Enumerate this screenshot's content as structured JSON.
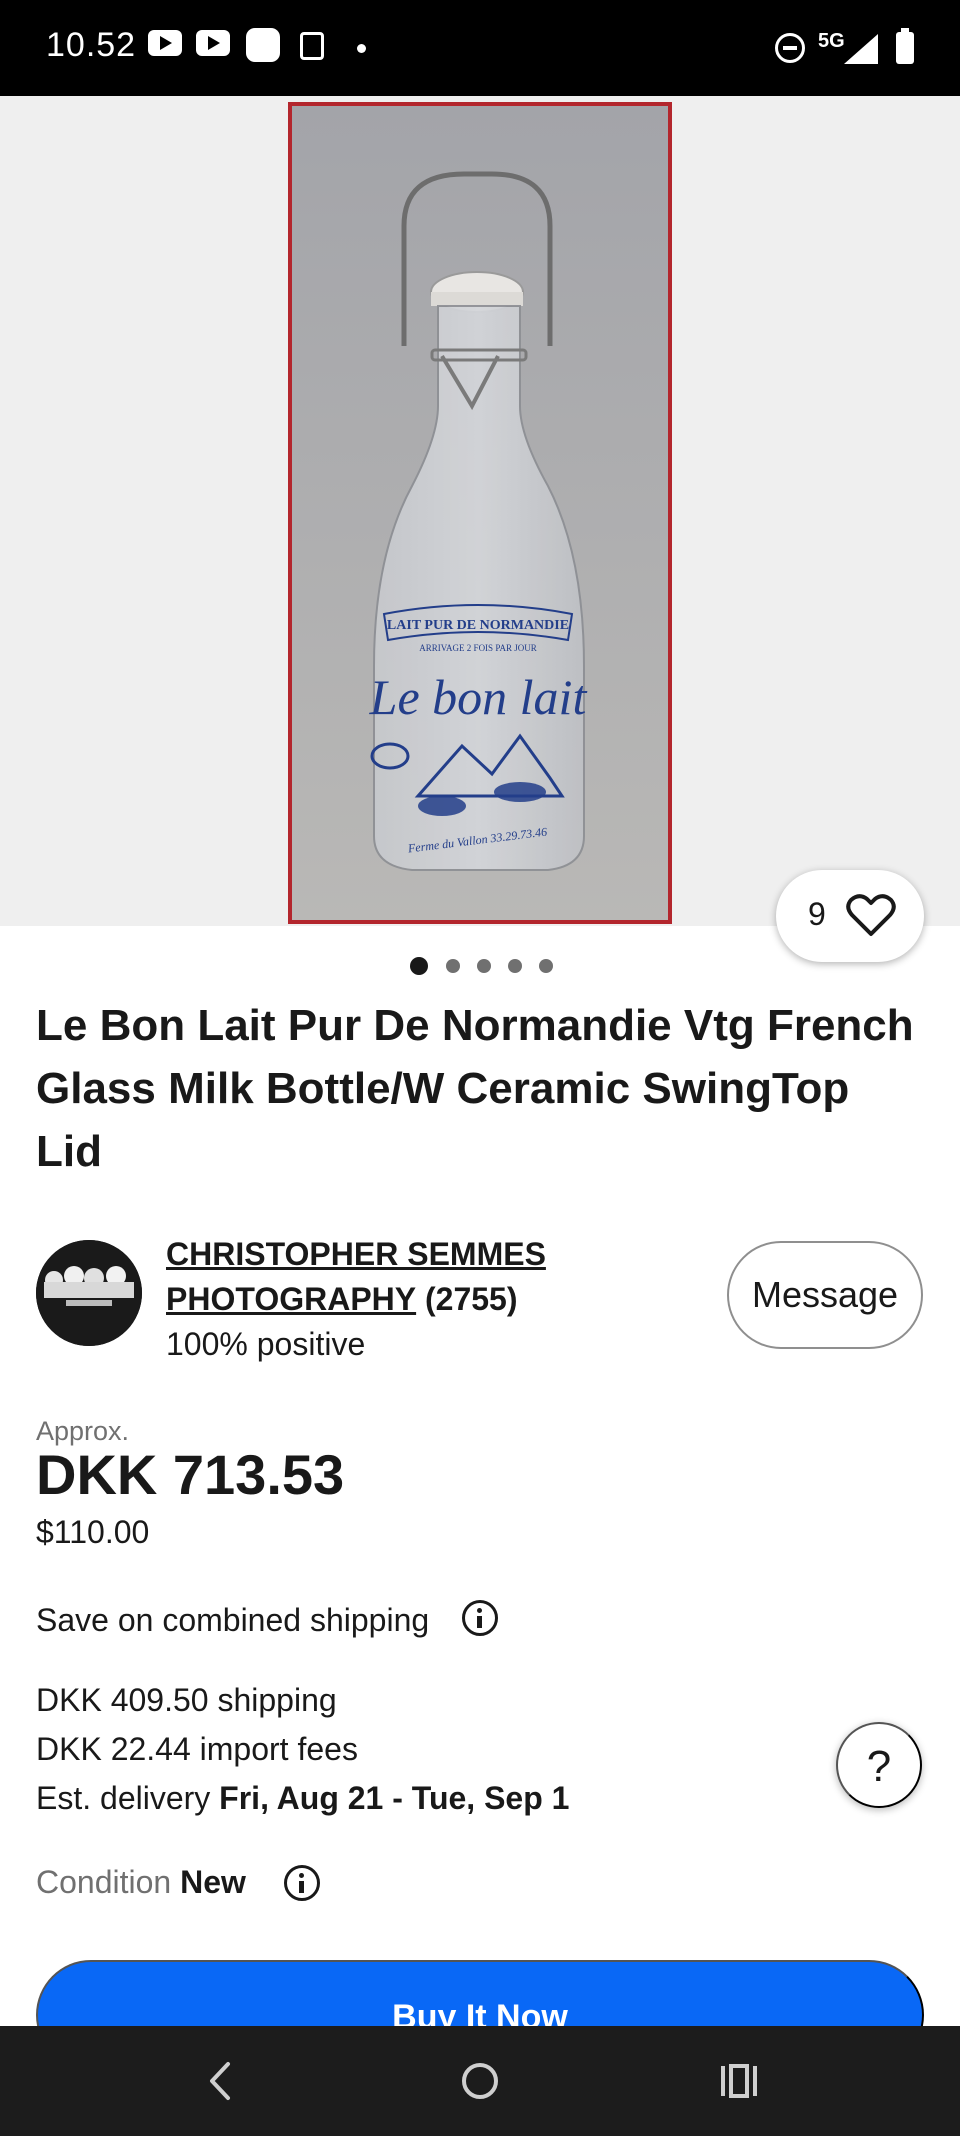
{
  "status_bar": {
    "time": "10.52",
    "network": "5G",
    "icons": [
      "youtube-icon",
      "youtube-icon",
      "app-icon",
      "note-icon",
      "dot-icon",
      "do-not-disturb-icon",
      "signal-icon",
      "battery-icon"
    ]
  },
  "gallery": {
    "bottle_label_top": "LAIT PUR DE NORMANDIE",
    "bottle_label_sub": "ARRIVAGE 2 FOIS PAR JOUR",
    "bottle_brand": "Le bon lait",
    "bottle_footer": "Ferme du Vallon  33.29.73.46",
    "image_count": 5,
    "active_index": 0,
    "watch_count": "9"
  },
  "listing": {
    "title": "Le Bon Lait Pur De Normandie Vtg French Glass Milk Bottle/W Ceramic SwingTop Lid"
  },
  "seller": {
    "name": "CHRISTOPHER SEMMES PHOTOGRAPHY",
    "feedback_count": "(2755)",
    "positive": "100% positive",
    "message_label": "Message"
  },
  "price": {
    "approx_label": "Approx.",
    "amount": "DKK 713.53",
    "original": "$110.00"
  },
  "shipping": {
    "combined_label": "Save on combined shipping",
    "shipping_cost": "DKK 409.50 shipping",
    "import_fees": "DKK 22.44 import fees",
    "delivery_label": "Est. delivery ",
    "delivery_dates": "Fri, Aug 21 - Tue, Sep 1"
  },
  "condition": {
    "label": "Condition",
    "value": "New"
  },
  "help_label": "?",
  "buy_label": "Buy It Now",
  "colors": {
    "accent": "#0968f6",
    "frame": "#b3262d",
    "text": "#191919",
    "muted": "#707070"
  }
}
